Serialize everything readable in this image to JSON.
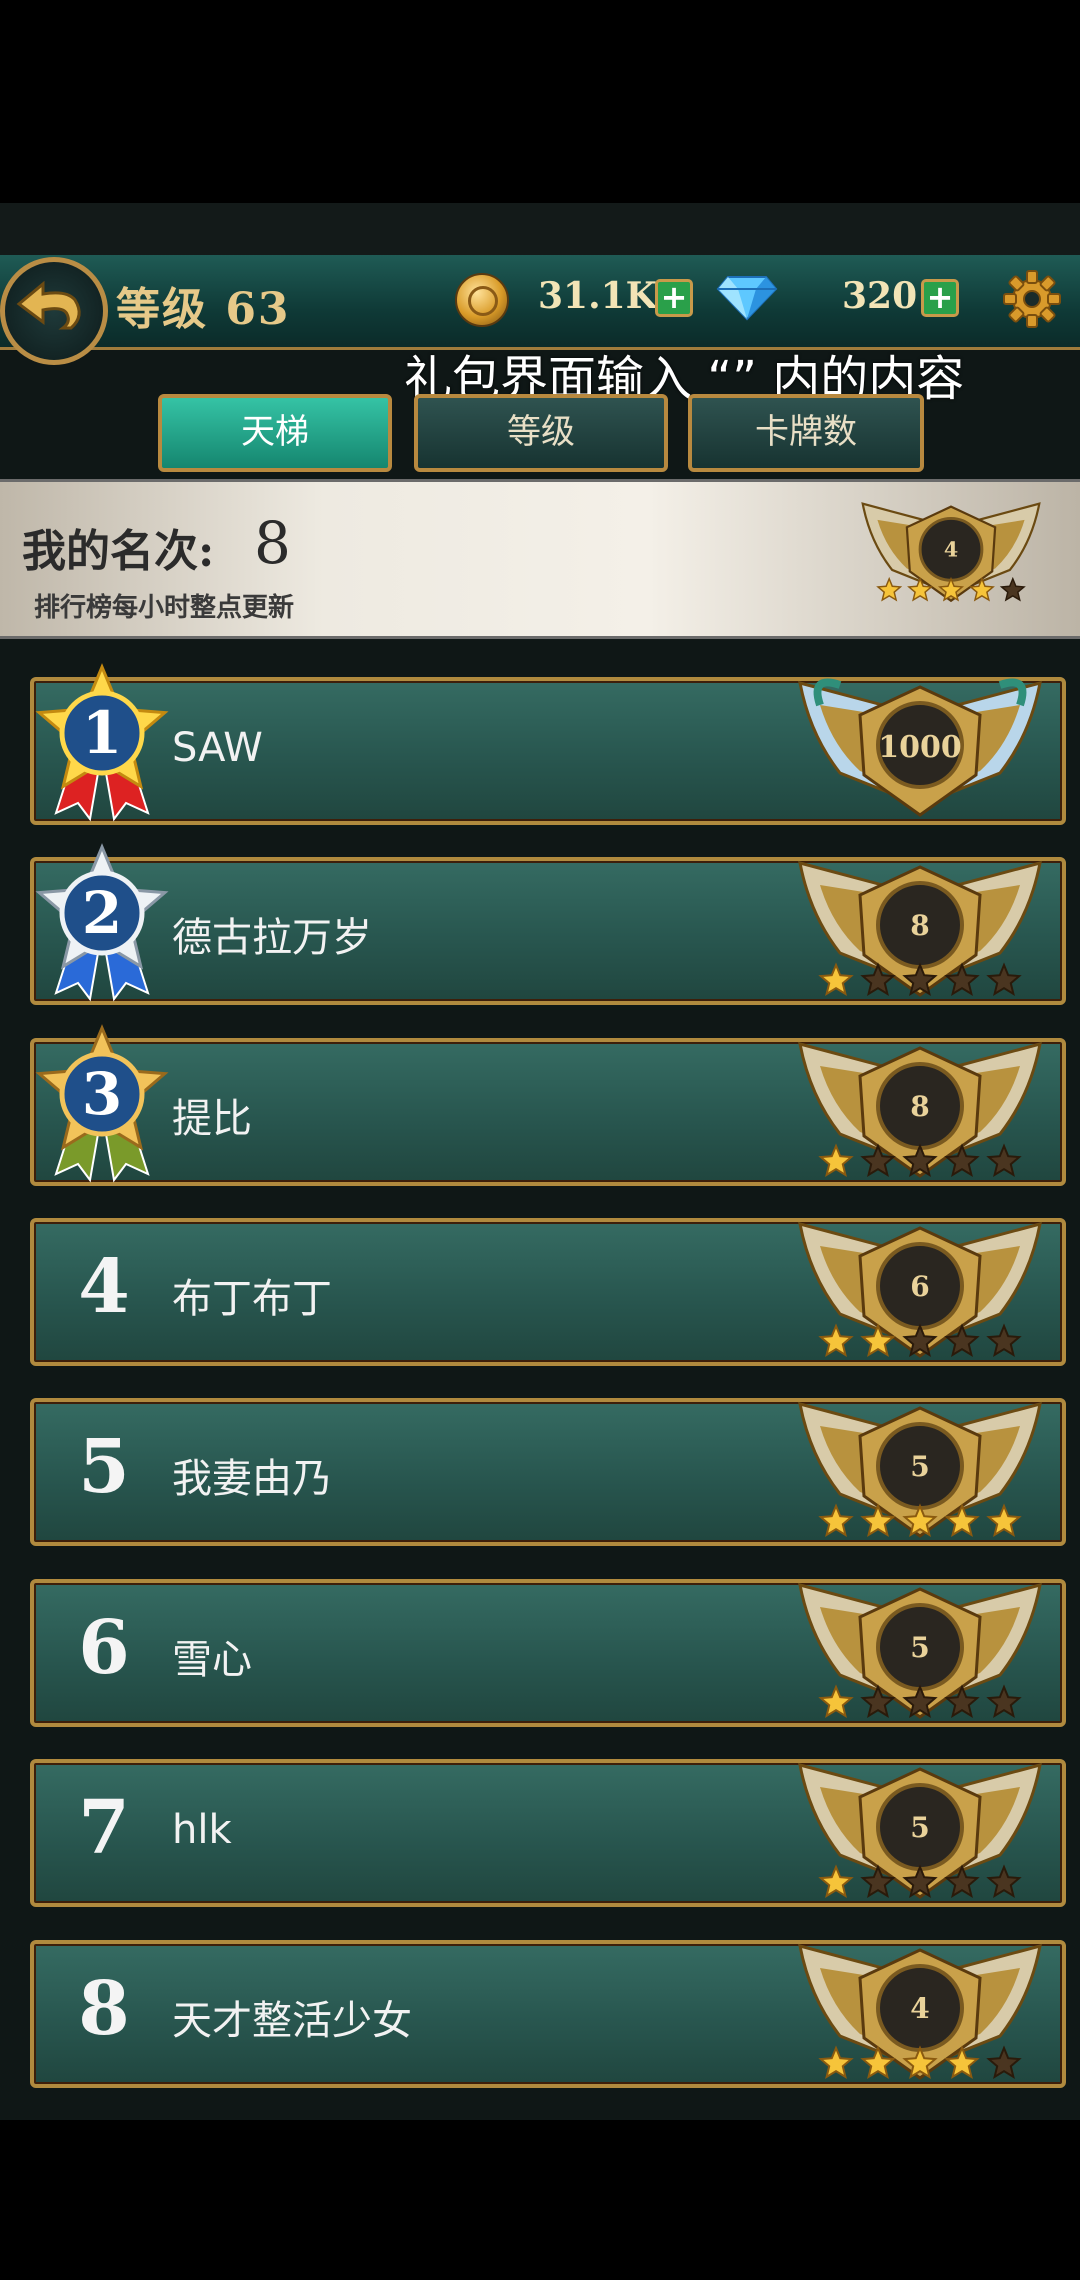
{
  "header": {
    "level_label": "等级 63",
    "coins": "31.1K",
    "gems": "320",
    "promo_text": "礼包界面输入 “” 内的内容"
  },
  "tabs": [
    {
      "label": "天梯",
      "active": true
    },
    {
      "label": "等级",
      "active": false
    },
    {
      "label": "卡牌数",
      "active": false
    }
  ],
  "my_rank": {
    "title": "我的名次:",
    "value": "8",
    "note": "排行榜每小时整点更新",
    "emblem_level": "4",
    "stars_filled": 4
  },
  "leaderboard": [
    {
      "rank": "1",
      "name": "SAW",
      "emblem_value": "1000",
      "stars_filled": 0,
      "medal": "gold"
    },
    {
      "rank": "2",
      "name": "德古拉万岁",
      "emblem_value": "8",
      "stars_filled": 1,
      "medal": "silver"
    },
    {
      "rank": "3",
      "name": "提比",
      "emblem_value": "8",
      "stars_filled": 1,
      "medal": "bronze"
    },
    {
      "rank": "4",
      "name": "布丁布丁",
      "emblem_value": "6",
      "stars_filled": 2
    },
    {
      "rank": "5",
      "name": "我妻由乃",
      "emblem_value": "5",
      "stars_filled": 5
    },
    {
      "rank": "6",
      "name": "雪心",
      "emblem_value": "5",
      "stars_filled": 1
    },
    {
      "rank": "7",
      "name": "hlk",
      "emblem_value": "5",
      "stars_filled": 1
    },
    {
      "rank": "8",
      "name": "天才整活少女",
      "emblem_value": "4",
      "stars_filled": 4
    }
  ],
  "colors": {
    "accent_gold": "#b08a3e",
    "row_teal": "#2b5a52",
    "active_tab": "#1fa285"
  }
}
